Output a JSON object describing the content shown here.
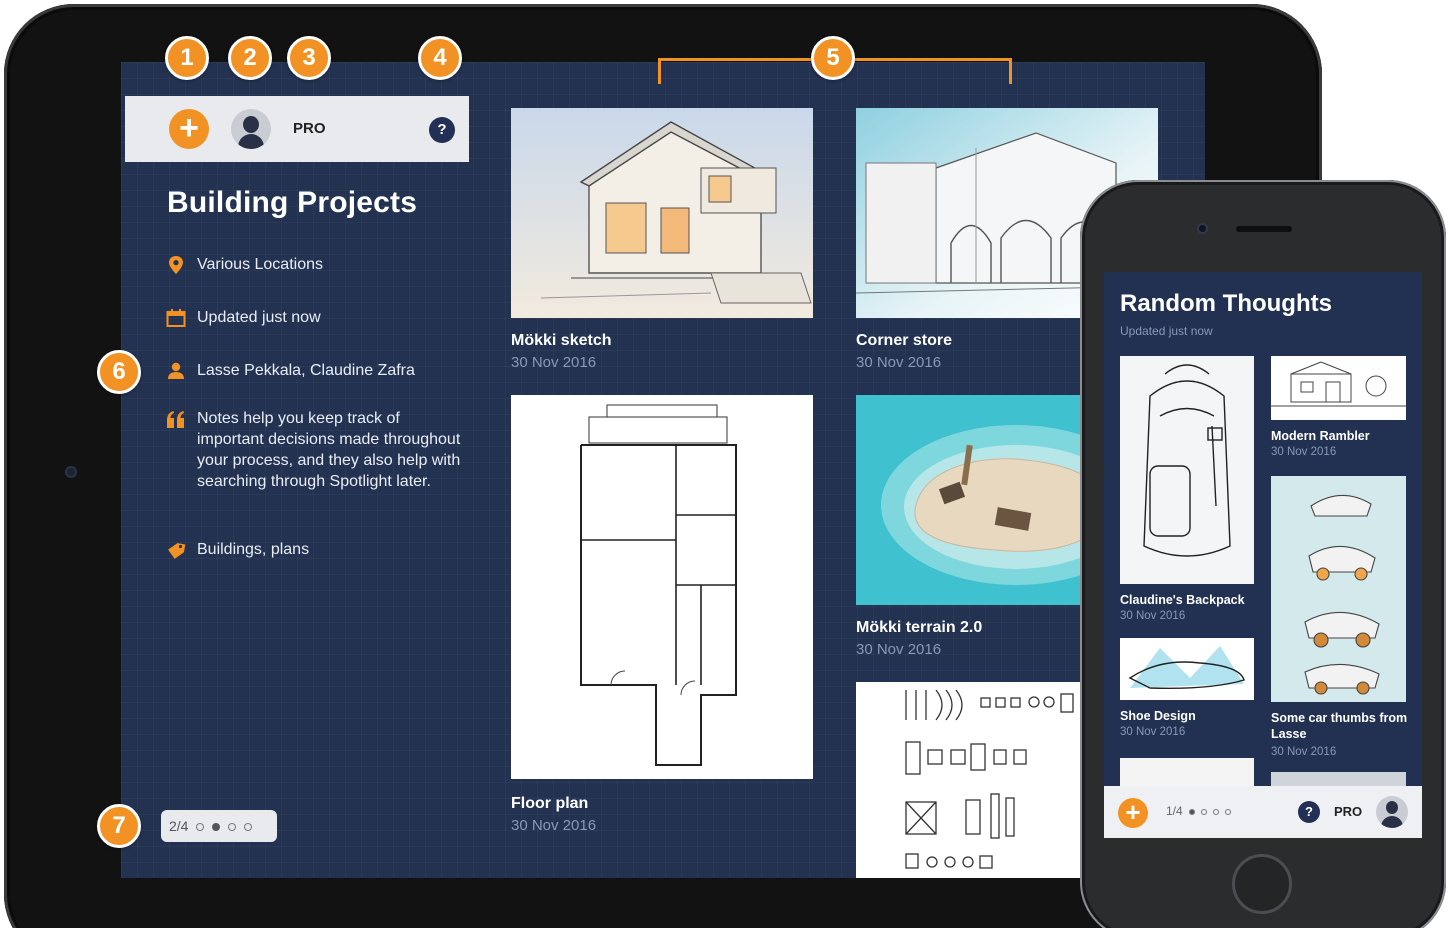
{
  "ipad": {
    "toolbar": {
      "add_label": "+",
      "pro_label": "PRO",
      "help_label": "?"
    },
    "project": {
      "title": "Building Projects",
      "location": "Various Locations",
      "updated": "Updated just now",
      "people": "Lasse Pekkala, Claudine Zafra",
      "notes": "Notes help you keep track of important decisions made throughout your process, and they also help with searching through Spotlight later.",
      "tags": "Buildings, plans"
    },
    "sketches": [
      {
        "title": "Mökki sketch",
        "date": "30 Nov 2016"
      },
      {
        "title": "Corner store",
        "date": "30 Nov 2016"
      },
      {
        "title": "Floor plan",
        "date": "30 Nov 2016"
      },
      {
        "title": "Mökki terrain 2.0",
        "date": "30 Nov 2016"
      }
    ],
    "pager": {
      "label": "2/4"
    }
  },
  "callouts": [
    "1",
    "2",
    "3",
    "4",
    "5",
    "6",
    "7"
  ],
  "iphone": {
    "project": {
      "title": "Random Thoughts",
      "updated": "Updated just now"
    },
    "sketches": [
      {
        "title": "Claudine's Backpack",
        "date": "30 Nov 2016"
      },
      {
        "title": "Modern Rambler",
        "date": "30 Nov 2016"
      },
      {
        "title": "Shoe Design",
        "date": "30 Nov 2016"
      },
      {
        "title": "Some car thumbs from Lasse",
        "date": "30 Nov 2016"
      }
    ],
    "bar": {
      "add_label": "+",
      "pager_label": "1/4",
      "help_label": "?",
      "pro_label": "PRO"
    }
  },
  "colors": {
    "accent": "#f39224",
    "background": "#233251",
    "toolbar": "#e9eaee"
  }
}
